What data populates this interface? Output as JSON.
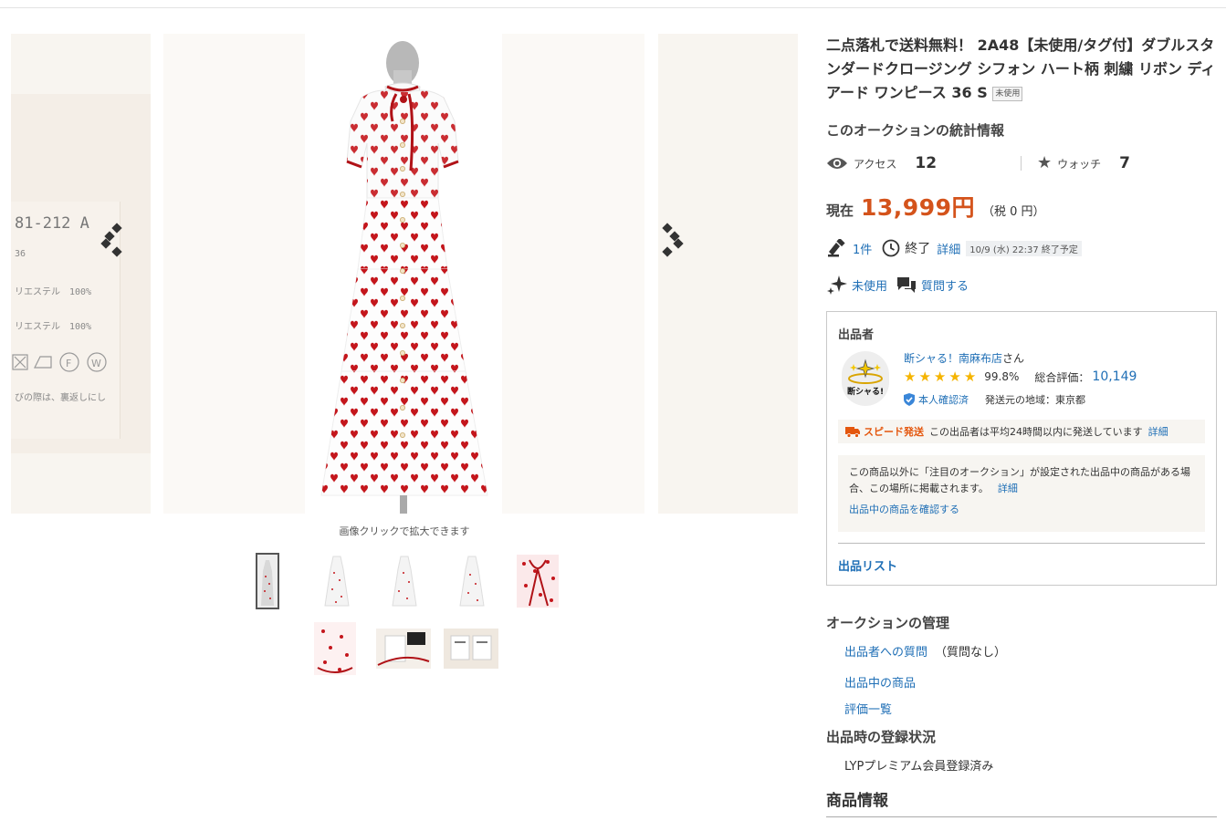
{
  "gallery": {
    "caption": "画像クリックで拡大できます",
    "tag_lines": [
      "81-212 A",
      "36",
      "リエステル　100%",
      "リエステル　100%",
      "びの際は、裏返しにし"
    ],
    "thumb_count": 8,
    "active_thumb": 1
  },
  "item": {
    "title": "二点落札で送料無料！ 2A48【未使用/タグ付】ダブルスタンダードクロージング シフォン ハート柄 刺繍 リボン ディアード ワンピース 36 S",
    "condition_badge": "未使用"
  },
  "stats": {
    "title": "このオークションの統計情報",
    "access_label": "アクセス",
    "access_value": "12",
    "watch_label": "ウォッチ",
    "watch_value": "7"
  },
  "price": {
    "label": "現在",
    "value": "13,999円",
    "tax": "（税 0 円）"
  },
  "meta": {
    "bids": "1件",
    "end_label": "終了",
    "detail_label": "詳細",
    "end_date": "10/9 (水) 22:37 終了予定",
    "condition": "未使用",
    "question": "質問する"
  },
  "seller": {
    "heading": "出品者",
    "avatar_text": "断シャる!",
    "name": "断シャる！南麻布店",
    "name_suffix": "さん",
    "rating_stars": 5,
    "rating_pct": "99.8%",
    "total_label": "総合評価：",
    "total_value": "10,149",
    "verified": "本人確認済",
    "region": "発送元の地域：東京都",
    "speed_label": "スピード発送",
    "speed_text": "この出品者は平均24時間以内に発送しています",
    "speed_detail": "詳細",
    "notice_text": "この商品以外に「注目のオークション」が設定された出品中の商品がある場合、この場所に掲載されます。",
    "notice_detail": "詳細",
    "notice_link": "出品中の商品を確認する",
    "list_link": "出品リスト"
  },
  "management": {
    "title": "オークションの管理",
    "question_link": "出品者への質問",
    "question_note": "（質問なし）",
    "items_link": "出品中の商品",
    "reviews_link": "評価一覧"
  },
  "registration": {
    "title": "出品時の登録状況",
    "status": "LYPプレミアム会員登録済み"
  },
  "product_info": {
    "title": "商品情報"
  },
  "colors": {
    "price": "#d4531b",
    "link": "#1f6fb6",
    "star": "#f5b400",
    "speed": "#e4570e",
    "heart": "#c4161c"
  }
}
